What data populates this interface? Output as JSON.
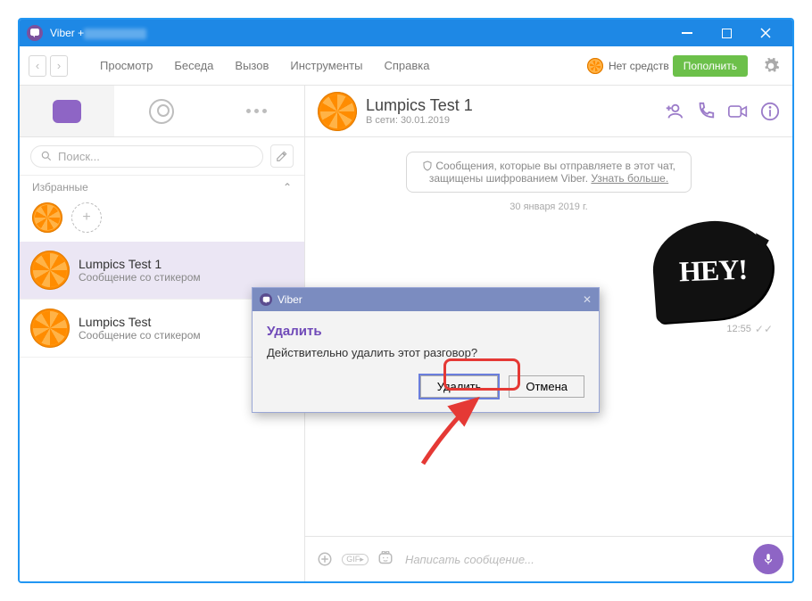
{
  "window": {
    "title_prefix": "Viber +"
  },
  "toolbar": {
    "menus": [
      "Просмотр",
      "Беседа",
      "Вызов",
      "Инструменты",
      "Справка"
    ],
    "balance_label": "Нет средств",
    "topup_label": "Пополнить"
  },
  "sidebar": {
    "search_placeholder": "Поиск...",
    "favorites_label": "Избранные",
    "chats": [
      {
        "name": "Lumpics Test 1",
        "preview": "Сообщение со стикером",
        "selected": true
      },
      {
        "name": "Lumpics Test",
        "preview": "Сообщение со стикером",
        "selected": false
      }
    ]
  },
  "conversation": {
    "title": "Lumpics Test 1",
    "status": "В сети: 30.01.2019",
    "system_msg": {
      "prefix": "Сообщения, которые вы отправляете в этот чат, защищены шифрованием Viber. ",
      "link": "Узнать больше."
    },
    "date_separator": "30 января 2019 г.",
    "sticker_text": "HEY!",
    "msg_time": "12:55",
    "composer_placeholder": "Написать сообщение..."
  },
  "dialog": {
    "titlebar": "Viber",
    "heading": "Удалить",
    "text": "Действительно удалить этот разговор?",
    "confirm": "Удалить",
    "cancel": "Отмена"
  }
}
